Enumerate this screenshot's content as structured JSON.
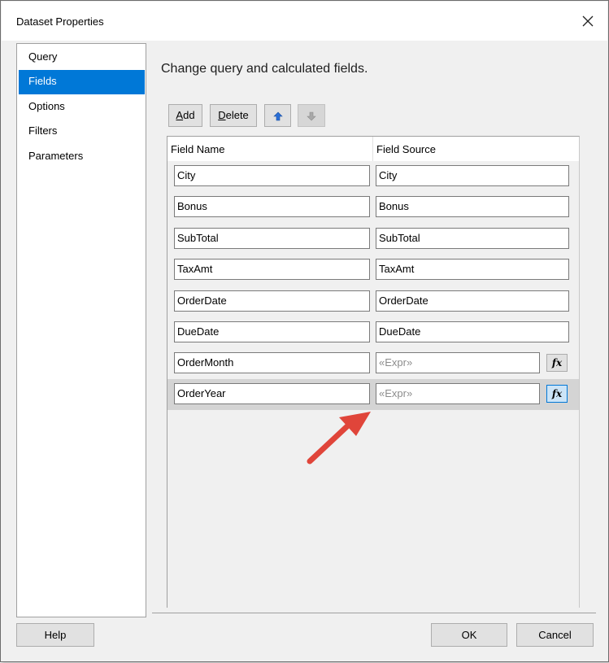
{
  "window": {
    "title": "Dataset Properties"
  },
  "nav": {
    "items": [
      {
        "label": "Query"
      },
      {
        "label": "Fields"
      },
      {
        "label": "Options"
      },
      {
        "label": "Filters"
      },
      {
        "label": "Parameters"
      }
    ],
    "selected": "Fields"
  },
  "main": {
    "heading": "Change query and calculated fields.",
    "toolbar": {
      "add_first": "A",
      "add_rest": "dd",
      "delete_first": "D",
      "delete_rest": "elete"
    },
    "columns": {
      "name": "Field Name",
      "source": "Field Source"
    },
    "rows": [
      {
        "name": "City",
        "source": "City"
      },
      {
        "name": "Bonus",
        "source": "Bonus"
      },
      {
        "name": "SubTotal",
        "source": "SubTotal"
      },
      {
        "name": "TaxAmt",
        "source": "TaxAmt"
      },
      {
        "name": "OrderDate",
        "source": "OrderDate"
      },
      {
        "name": "DueDate",
        "source": "DueDate"
      },
      {
        "name": "OrderMonth",
        "source": "«Expr»"
      },
      {
        "name": "OrderYear",
        "source": "«Expr»"
      }
    ],
    "expression_button": "fx"
  },
  "footer": {
    "help": "Help",
    "ok": "OK",
    "cancel": "Cancel"
  },
  "colors": {
    "selection": "#0078d7",
    "arrow": "#e0453a"
  }
}
